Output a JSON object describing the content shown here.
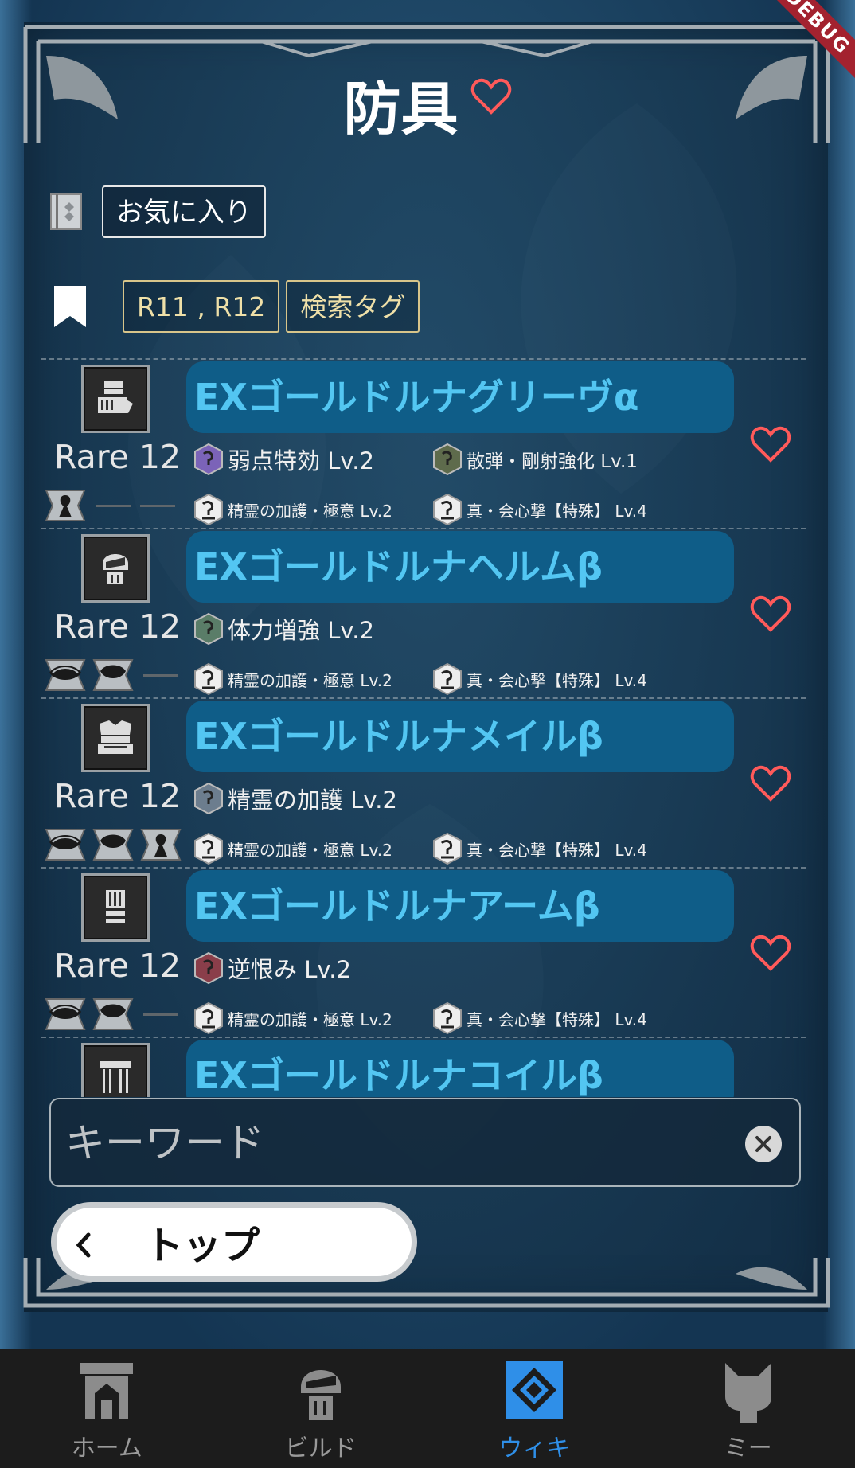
{
  "debug_ribbon": "DEBUG",
  "title": "防具",
  "favorites_label": "お気に入り",
  "tags": [
    "R11 , R12",
    "検索タグ"
  ],
  "colors": {
    "name_bg": "#0f5d88",
    "name_text": "#53c6f2",
    "heart": "#ff5a5a",
    "active_nav": "#2f8fe8"
  },
  "items": [
    {
      "icon": "gloves-icon",
      "name": "EXゴールドルナグリーヴα",
      "rarity": "Rare 12",
      "skills": [
        {
          "name": "弱点特効 Lv.2",
          "color": "#7b63b8"
        },
        {
          "name": "散弾・剛射強化 Lv.1",
          "color": "#5e6b4c"
        }
      ],
      "set_skills": [
        "精霊の加護・極意 Lv.2",
        "真・会心撃【特殊】 Lv.4"
      ],
      "slots": [
        "slot-level-1",
        "empty",
        "empty"
      ]
    },
    {
      "icon": "helm-icon",
      "name": "EXゴールドルナヘルムβ",
      "rarity": "Rare 12",
      "skills": [
        {
          "name": "体力増強 Lv.2",
          "color": "#5a7d68"
        }
      ],
      "set_skills": [
        "精霊の加護・極意 Lv.2",
        "真・会心撃【特殊】 Lv.4"
      ],
      "slots": [
        "slot-level-4",
        "slot-level-3",
        "empty"
      ]
    },
    {
      "icon": "mail-icon",
      "name": "EXゴールドルナメイルβ",
      "rarity": "Rare 12",
      "skills": [
        {
          "name": "精霊の加護 Lv.2",
          "color": "#6c7d8e"
        }
      ],
      "set_skills": [
        "精霊の加護・極意 Lv.2",
        "真・会心撃【特殊】 Lv.4"
      ],
      "slots": [
        "slot-level-4",
        "slot-level-3",
        "slot-level-1"
      ]
    },
    {
      "icon": "arm-icon",
      "name": "EXゴールドルナアームβ",
      "rarity": "Rare 12",
      "skills": [
        {
          "name": "逆恨み Lv.2",
          "color": "#8a3e4a"
        }
      ],
      "set_skills": [
        "精霊の加護・極意 Lv.2",
        "真・会心撃【特殊】 Lv.4"
      ],
      "slots": [
        "slot-level-4",
        "slot-level-3",
        "empty"
      ]
    },
    {
      "icon": "coil-icon",
      "name": "EXゴールドルナコイルβ",
      "rarity": "",
      "skills": [],
      "set_skills": [],
      "slots": []
    }
  ],
  "search": {
    "placeholder": "キーワード",
    "value": ""
  },
  "back_button": "トップ",
  "nav": [
    {
      "label": "ホーム",
      "icon": "fortress-icon",
      "active": false
    },
    {
      "label": "ビルド",
      "icon": "armor-helm-icon",
      "active": false
    },
    {
      "label": "ウィキ",
      "icon": "wiki-icon",
      "active": true
    },
    {
      "label": "ミー",
      "icon": "palico-icon",
      "active": false
    }
  ]
}
